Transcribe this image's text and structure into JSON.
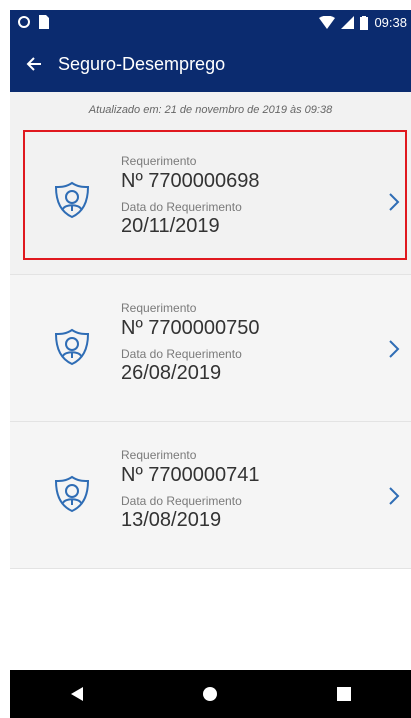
{
  "status_bar": {
    "time": "09:38"
  },
  "header": {
    "title": "Seguro-Desemprego"
  },
  "updated": {
    "text": "Atualizado em: 21 de novembro de 2019 às 09:38"
  },
  "requests": [
    {
      "label": "Requerimento",
      "number": "Nº 7700000698",
      "date_label": "Data do Requerimento",
      "date": "20/11/2019"
    },
    {
      "label": "Requerimento",
      "number": "Nº 7700000750",
      "date_label": "Data do Requerimento",
      "date": "26/08/2019"
    },
    {
      "label": "Requerimento",
      "number": "Nº 7700000741",
      "date_label": "Data do Requerimento",
      "date": "13/08/2019"
    }
  ],
  "icons": {
    "back": "arrow-left-icon",
    "request": "shield-person-icon",
    "chevron": "chevron-right-icon",
    "nav_back": "triangle-back-icon",
    "nav_home": "circle-home-icon",
    "nav_recents": "square-recents-icon"
  },
  "colors": {
    "brand": "#0b2b6f",
    "accent": "#2f6db5",
    "highlight_border": "#e0191f"
  }
}
